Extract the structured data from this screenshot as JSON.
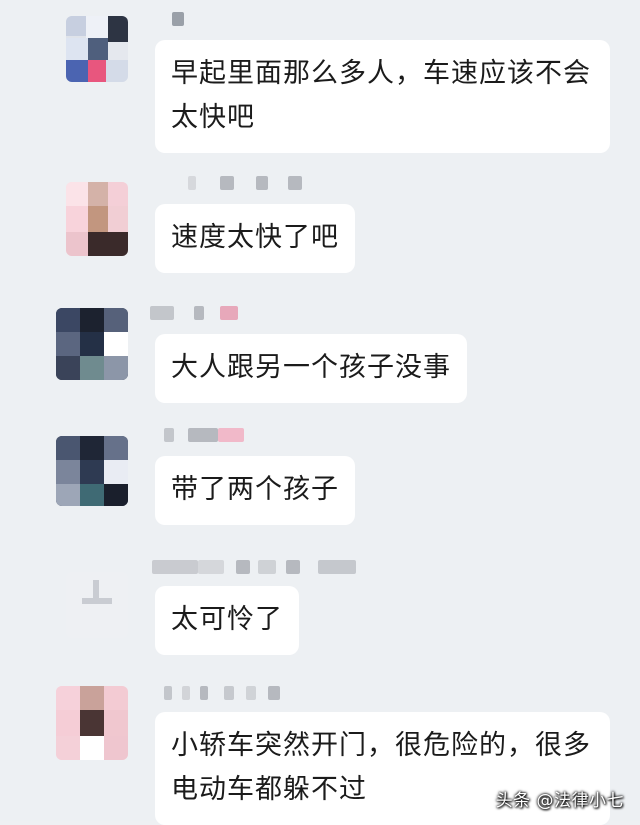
{
  "chat": {
    "messages": [
      {
        "text": "早起里面那么多人，车速应该不会太快吧"
      },
      {
        "text": "速度太快了吧"
      },
      {
        "text": "大人跟另一个孩子没事"
      },
      {
        "text": "带了两个孩子"
      },
      {
        "text": "太可怜了"
      },
      {
        "text": "小轿车突然开门，很危险的，很多电动车都躲不过"
      }
    ]
  },
  "watermark": {
    "text": "头条 @法律小七"
  },
  "colors": {
    "background": "#edf0f3",
    "bubble": "#ffffff",
    "text": "#1b1b1b"
  }
}
